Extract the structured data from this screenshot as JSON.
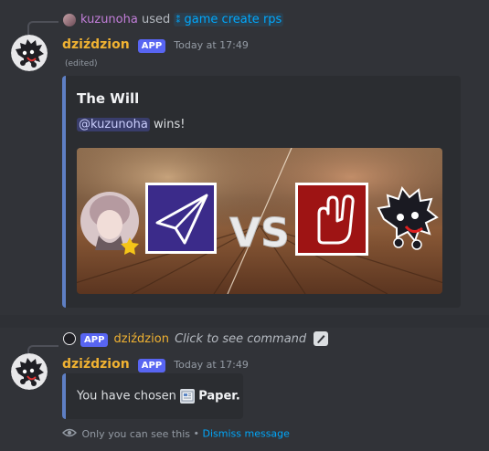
{
  "message1": {
    "reply": {
      "username": "kuzunoha",
      "action": "used",
      "command": "game create rps"
    },
    "author": "dziździon",
    "app_tag": "APP",
    "timestamp": "Today at 17:49",
    "edited": "(edited)",
    "embed": {
      "title": "The Will",
      "mention": "@kuzunoha",
      "result_text": " wins!",
      "vs_text": "VS"
    }
  },
  "message2": {
    "reply": {
      "app_tag": "APP",
      "author": "dziździon",
      "hint": "Click to see command"
    },
    "author": "dziździon",
    "app_tag": "APP",
    "timestamp": "Today at 17:49",
    "body_prefix": "You have chosen ",
    "choice": "Paper.",
    "ephemeral_notice": "Only you can see this",
    "separator": "•",
    "dismiss": "Dismiss message"
  },
  "colors": {
    "background": "#313338",
    "embed_bg": "#2b2d31",
    "embed_border": "#5e7fc4",
    "username": "#f0b232",
    "app_badge": "#5865f2",
    "link": "#00a8fc"
  },
  "icons": {
    "command_icon": "slash-command-icon",
    "paper_icon": "newspaper-emoji-icon",
    "eye_icon": "eye-icon",
    "edit_icon": "pencil-square-icon"
  }
}
